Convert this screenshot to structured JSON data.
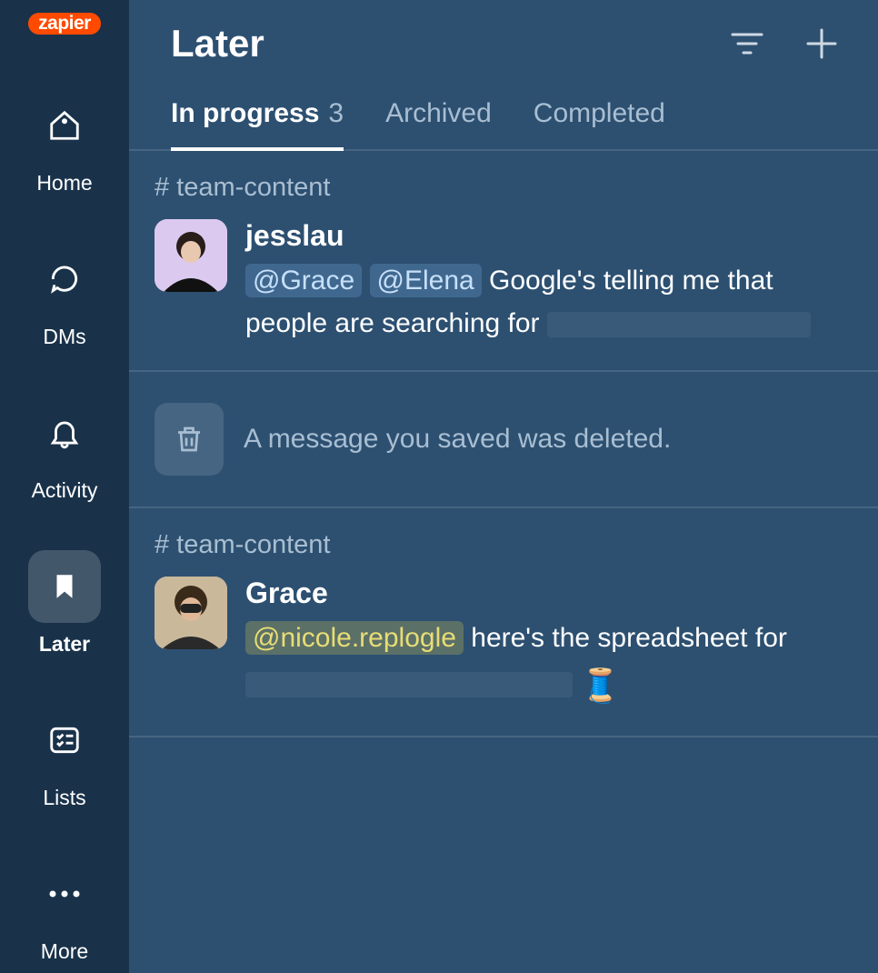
{
  "workspace": {
    "name": "zapier"
  },
  "sidebar": {
    "items": [
      {
        "label": "Home"
      },
      {
        "label": "DMs"
      },
      {
        "label": "Activity"
      },
      {
        "label": "Later"
      },
      {
        "label": "Lists"
      },
      {
        "label": "More"
      }
    ]
  },
  "header": {
    "title": "Later"
  },
  "tabs": [
    {
      "label": "In progress",
      "count": "3",
      "active": true
    },
    {
      "label": "Archived",
      "active": false
    },
    {
      "label": "Completed",
      "active": false
    }
  ],
  "items": [
    {
      "type": "message",
      "channel": "# team-content",
      "author": "jesslau",
      "mentions": [
        "@Grace",
        "@Elena"
      ],
      "text_before": "",
      "text_after": " Google's telling me that people are searching for ",
      "redacted_trail": true
    },
    {
      "type": "deleted",
      "text": "A message you saved was deleted."
    },
    {
      "type": "message",
      "channel": "# team-content",
      "author": "Grace",
      "mentions_self": [
        "@nicole.replogle"
      ],
      "text_after": " here's the spreadsheet for ",
      "redacted_trail": true,
      "emoji": "🧵"
    }
  ]
}
